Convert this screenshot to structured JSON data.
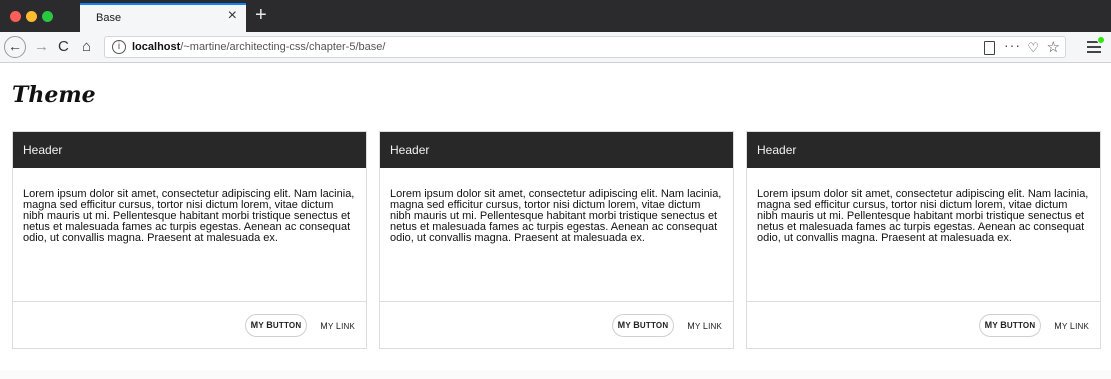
{
  "browser": {
    "tab_title": "Base",
    "tab_close": "×",
    "new_tab": "+",
    "url_host": "localhost",
    "url_path": "/~martine/architecting-css/chapter-5/base/",
    "icons": {
      "back": "←",
      "forward": "→",
      "reload": "C",
      "home": "⌂",
      "info": "i",
      "more": "···",
      "pocket": "♡",
      "star": "☆"
    }
  },
  "page": {
    "title": "Theme"
  },
  "cards": [
    {
      "header": "Header",
      "body": "Lorem ipsum dolor sit amet, consectetur adipiscing elit. Nam lacinia, magna sed efficitur cursus, tortor nisi dictum lorem, vitae dictum nibh mauris ut mi. Pellentesque habitant morbi tristique senectus et netus et malesuada fames ac turpis egestas. Aenean ac consequat odio, ut convallis magna. Praesent at malesuada ex.",
      "button_label": "My Button",
      "link_label": "My Link"
    },
    {
      "header": "Header",
      "body": "Lorem ipsum dolor sit amet, consectetur adipiscing elit. Nam lacinia, magna sed efficitur cursus, tortor nisi dictum lorem, vitae dictum nibh mauris ut mi. Pellentesque habitant morbi tristique senectus et netus et malesuada fames ac turpis egestas. Aenean ac consequat odio, ut convallis magna. Praesent at malesuada ex.",
      "button_label": "My Button",
      "link_label": "My Link"
    },
    {
      "header": "Header",
      "body": "Lorem ipsum dolor sit amet, consectetur adipiscing elit. Nam lacinia, magna sed efficitur cursus, tortor nisi dictum lorem, vitae dictum nibh mauris ut mi. Pellentesque habitant morbi tristique senectus et netus et malesuada fames ac turpis egestas. Aenean ac consequat odio, ut convallis magna. Praesent at malesuada ex.",
      "button_label": "My Button",
      "link_label": "My Link"
    }
  ],
  "colors": {
    "card_header_bg": "#282828",
    "tab_accent": "#0a84ff",
    "chrome_dark": "#2b2b2e"
  }
}
